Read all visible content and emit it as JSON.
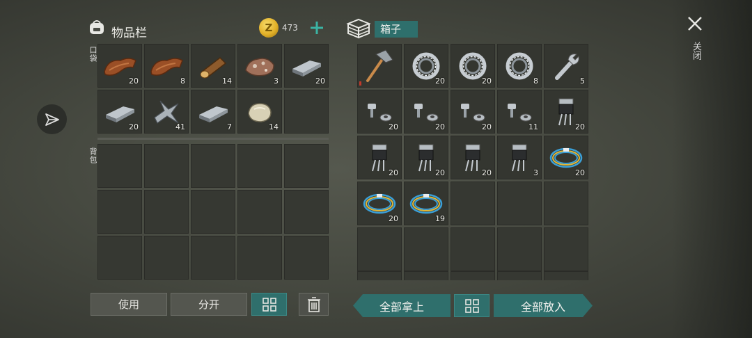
{
  "inventory": {
    "title": "物品栏",
    "coin_symbol": "Z",
    "coin_count": "473",
    "pocket_label": "口袋",
    "backpack_label": "背包",
    "pocket_slots": [
      {
        "item": "leather",
        "qty": "20"
      },
      {
        "item": "leather",
        "qty": "8"
      },
      {
        "item": "wood-log",
        "qty": "14"
      },
      {
        "item": "iron-ore",
        "qty": "3"
      },
      {
        "item": "iron-ingot",
        "qty": "20"
      },
      {
        "item": "iron-ingot",
        "qty": "20"
      },
      {
        "item": "iron-scrap",
        "qty": "41"
      },
      {
        "item": "iron-ingot",
        "qty": "7"
      },
      {
        "item": "stone",
        "qty": "14"
      },
      {
        "item": "",
        "qty": ""
      }
    ]
  },
  "box": {
    "title": "箱子",
    "slots": [
      {
        "item": "hammer",
        "qty": ""
      },
      {
        "item": "bearing",
        "qty": "20"
      },
      {
        "item": "bearing",
        "qty": "20"
      },
      {
        "item": "bearing",
        "qty": "8"
      },
      {
        "item": "wrench",
        "qty": "5"
      },
      {
        "item": "bolts-nuts",
        "qty": "20"
      },
      {
        "item": "bolts-nuts",
        "qty": "20"
      },
      {
        "item": "bolts-nuts",
        "qty": "20"
      },
      {
        "item": "bolts-nuts",
        "qty": "11"
      },
      {
        "item": "transistor",
        "qty": "20"
      },
      {
        "item": "transistor",
        "qty": "20"
      },
      {
        "item": "transistor",
        "qty": "20"
      },
      {
        "item": "transistor",
        "qty": "20"
      },
      {
        "item": "transistor",
        "qty": "3"
      },
      {
        "item": "wire-coil",
        "qty": "20"
      },
      {
        "item": "wire-coil",
        "qty": "20"
      },
      {
        "item": "wire-coil",
        "qty": "19"
      }
    ]
  },
  "close_label": "关闭",
  "buttons": {
    "use": "使用",
    "split": "分开",
    "take_all": "全部拿上",
    "put_all": "全部放入"
  },
  "colors": {
    "accent": "#2f6f6c",
    "slot": "#343630",
    "coin": "#e2b128"
  }
}
